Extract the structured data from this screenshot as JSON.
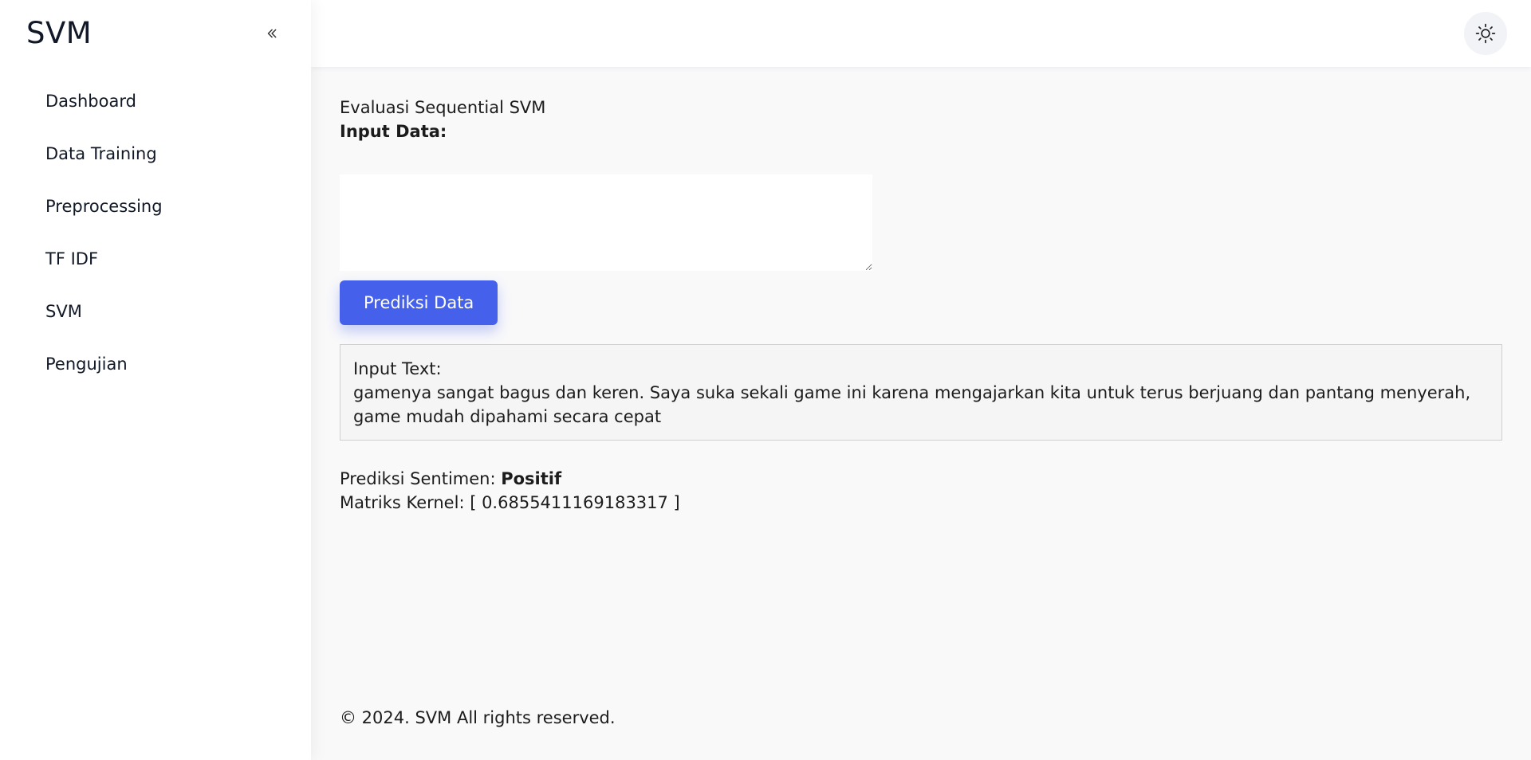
{
  "sidebar": {
    "brand": "SVM",
    "collapse_icon": "chevrons-left-icon",
    "items": [
      {
        "label": "Dashboard"
      },
      {
        "label": "Data Training"
      },
      {
        "label": "Preprocessing"
      },
      {
        "label": "TF IDF"
      },
      {
        "label": "SVM"
      },
      {
        "label": "Pengujian"
      }
    ]
  },
  "header": {
    "theme_icon": "sun-icon"
  },
  "main": {
    "title": "Evaluasi Sequential SVM",
    "input_label": "Input Data:",
    "textarea_value": "",
    "predict_button": "Prediksi Data",
    "result": {
      "input_text_label": "Input Text:",
      "input_text": "gamenya sangat bagus dan keren. Saya suka sekali game ini karena mengajarkan kita untuk terus berjuang dan pantang menyerah, game mudah dipahami secara cepat"
    },
    "prediction_label": "Prediksi Sentimen: ",
    "prediction_value": "Positif",
    "kernel_label": "Matriks Kernel: ",
    "kernel_value": "[ 0.6855411169183317 ]"
  },
  "footer": {
    "text": "© 2024. SVM All rights reserved."
  },
  "colors": {
    "accent": "#4561ec",
    "background": "#f9f9fa",
    "sidebar": "#ffffff"
  }
}
